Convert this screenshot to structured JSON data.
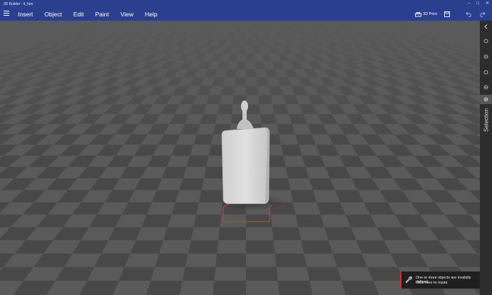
{
  "window": {
    "title": "3D Builder - lt_fum"
  },
  "menubar": {
    "items": [
      "Insert",
      "Object",
      "Edit",
      "Paint",
      "View",
      "Help"
    ],
    "print_label": "3D Print"
  },
  "right_panel": {
    "selection_label": "Selection"
  },
  "toast": {
    "line1": "One or more objects are invalidly defined.",
    "line2": "Click here to repair."
  },
  "icons": {
    "hamburger": "hamburger-menu-icon",
    "print": "3d-print-icon",
    "save": "save-icon",
    "undo": "undo-icon",
    "redo": "redo-icon",
    "collapse": "chevron-left-icon",
    "repair": "wrench-icon"
  },
  "colors": {
    "titlebar": "#2b3f8f",
    "panel": "#2d2d2d",
    "toast_accent": "#c9313d",
    "bounds": "#d43a3a"
  }
}
